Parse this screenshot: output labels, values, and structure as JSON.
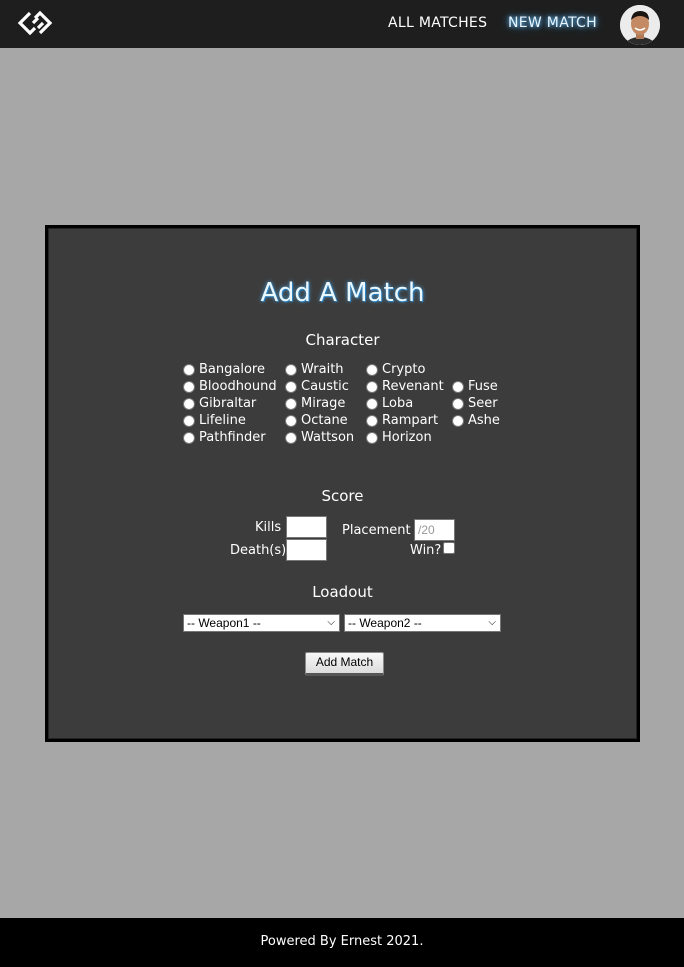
{
  "header": {
    "nav": {
      "all_matches": "ALL MATCHES",
      "new_match": "NEW MATCH"
    },
    "logo_icon": "diamond-chain-logo",
    "avatar_icon": "user-avatar"
  },
  "form": {
    "title": "Add A Match",
    "character": {
      "title": "Character",
      "columns": [
        [
          "Bangalore",
          "Bloodhound",
          "Gibraltar",
          "Lifeline",
          "Pathfinder"
        ],
        [
          "Wraith",
          "Caustic",
          "Mirage",
          "Octane",
          "Wattson"
        ],
        [
          "Crypto",
          "Revenant",
          "Loba",
          "Rampart",
          "Horizon"
        ],
        [
          "Fuse",
          "Seer",
          "Ashe"
        ]
      ]
    },
    "score": {
      "title": "Score",
      "kills_label": "Kills",
      "deaths_label": "Death(s)",
      "placement_label": "Placement",
      "placement_placeholder": "/20",
      "win_label": "Win?"
    },
    "loadout": {
      "title": "Loadout",
      "weapon1": "-- Weapon1 --",
      "weapon2": "-- Weapon2 --"
    },
    "submit_label": "Add Match"
  },
  "footer": {
    "text": "Powered By Ernest 2021."
  },
  "colors": {
    "page_bg": "#a7a7a7",
    "header_bg": "#1e1e1e",
    "card_bg": "#3c3c3c",
    "title_glow": "#4aa8e8",
    "footer_bg": "#000000"
  }
}
